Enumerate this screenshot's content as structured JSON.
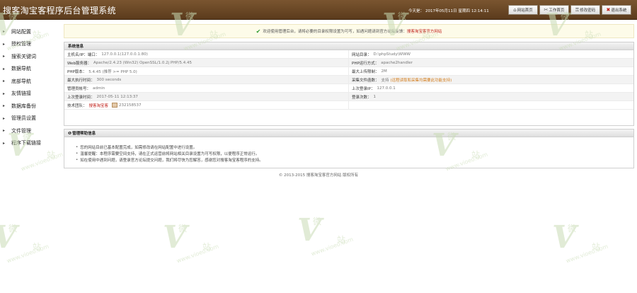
{
  "header": {
    "title": "搜客淘宝客程序后台管理系统",
    "date_prefix": "今天是：",
    "date": "2017年05月11日",
    "weekday": "星期四",
    "time": "12:14:11",
    "buttons": [
      {
        "label": "网站首页",
        "icon": "home-icon"
      },
      {
        "label": "工作首页",
        "icon": "tools-icon"
      },
      {
        "label": "修改密码",
        "icon": "key-icon"
      },
      {
        "label": "退出系统",
        "icon": "close-icon"
      }
    ]
  },
  "sidebar": {
    "items": [
      "网站配置",
      "授权管理",
      "搜索关键词",
      "数据导航",
      "底部导航",
      "友情链接",
      "数据库备份",
      "管理员设置",
      "文件管理",
      "程序下载链接"
    ]
  },
  "notice": {
    "text": "欢迎使用管理后台，请将必要的目录权限设置为可写，如遇问题请到官方论坛反馈：",
    "link": "搜客淘宝客官方网站"
  },
  "system": {
    "title": "系统信息",
    "rows": [
      {
        "k": "主机名/IP：端口：",
        "v": "127.0.0.1(127.0.0.1:80)"
      },
      {
        "k": "网站目录：",
        "v": "D:\\phpStudy\\WWW"
      },
      {
        "k": "Web服务器：",
        "v": "Apache/2.4.23 (Win32) OpenSSL/1.0.2j PHP/5.4.45"
      },
      {
        "k": "PHP运行方式：",
        "v": "apache2handler"
      },
      {
        "k": "PHP版本：",
        "v": "5.4.45 (推荐 >= PHP 5.0)"
      },
      {
        "k": "最大上传限制：",
        "v": "2M"
      },
      {
        "k": "最大执行时间：",
        "v": "300 seconds"
      },
      {
        "k": "采集文件函数：",
        "v": "支持",
        "extra": "(远程读取和采集均需要此功能支持)"
      },
      {
        "k": "管理员帐号：",
        "v": "admin"
      },
      {
        "k": "上次登录IP：",
        "v": "127.0.0.1"
      },
      {
        "k": "上次登录时间：",
        "v": "2017-05-11 12:13:37"
      },
      {
        "k": "登录次数：",
        "v": "1"
      },
      {
        "k": "技术团队：",
        "v": "搜客淘宝客",
        "qq": "232158537"
      },
      {
        "k": "",
        "v": ""
      }
    ]
  },
  "help": {
    "title": "管理帮助信息",
    "lines": [
      "您的网站目前已基本配置完成，如需修改请在网站配置中进行设置。",
      "温馨提醒：本程序需要空间支持，请在正式运营前将网站相关目录设置为可写权限，以便程序正常运行。",
      "如在使用中遇到问题，请登录官方论坛提交问题，我们将尽快为您解答，感谢您对搜客淘宝客程序的支持。"
    ]
  },
  "footer": {
    "text": "© 2013-2015 搜客淘宝客官方网站 版权所有"
  },
  "watermark": {
    "letter": "V",
    "chars": [
      "微",
      "站"
    ],
    "url": "www.vioeo.com"
  }
}
